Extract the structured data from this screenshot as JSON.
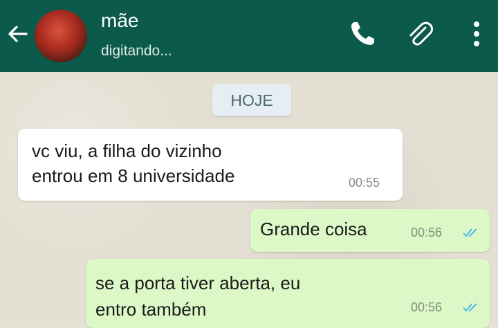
{
  "header": {
    "contact_name": "mãe",
    "status": "digitando...",
    "icons": [
      "back-arrow-icon",
      "phone-icon",
      "paperclip-icon",
      "more-vert-icon"
    ],
    "bg_color": "#0c5a4b"
  },
  "chat": {
    "date_chip": "HOJE",
    "messages": [
      {
        "direction": "incoming",
        "lines": [
          "vc viu, a filha do vizinho",
          "entrou em 8 universidade"
        ],
        "time": "00:55"
      },
      {
        "direction": "outgoing",
        "lines": [
          "Grande coisa"
        ],
        "time": "00:56",
        "status": "read"
      },
      {
        "direction": "outgoing",
        "lines": [
          "se a porta tiver aberta, eu",
          "entro também"
        ],
        "time": "00:56",
        "status": "read"
      }
    ],
    "outgoing_color": "#dcf8c6",
    "incoming_color": "#ffffff",
    "read_tick_color": "#4fb6ec"
  }
}
